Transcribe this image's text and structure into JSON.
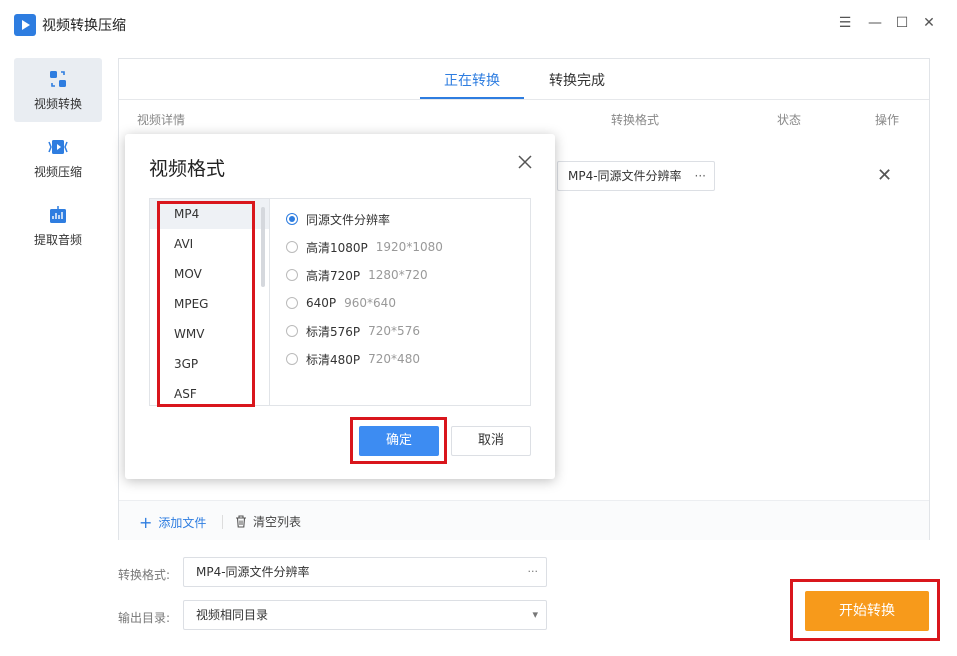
{
  "app": {
    "title": "视频转换压缩"
  },
  "window_controls": {
    "menu": "☰",
    "minimize": "—",
    "maximize": "☐",
    "close": "✕"
  },
  "sidebar": {
    "items": [
      {
        "label": "视频转换",
        "icon": "convert-icon",
        "active": true
      },
      {
        "label": "视频压缩",
        "icon": "compress-icon",
        "active": false
      },
      {
        "label": "提取音频",
        "icon": "audio-icon",
        "active": false
      }
    ]
  },
  "tabs": [
    {
      "label": "正在转换",
      "active": true
    },
    {
      "label": "转换完成",
      "active": false
    }
  ],
  "table": {
    "headers": {
      "details": "视频详情",
      "format": "转换格式",
      "status": "状态",
      "action": "操作"
    },
    "row": {
      "format": "MP4-同源文件分辨率",
      "format_more": "···",
      "delete": "✕"
    }
  },
  "footer": {
    "add_files": "添加文件",
    "clear_list": "清空列表"
  },
  "dialog": {
    "title": "视频格式",
    "formats": [
      "MP4",
      "AVI",
      "MOV",
      "MPEG",
      "WMV",
      "3GP",
      "ASF"
    ],
    "selected_format": "MP4",
    "resolutions": [
      {
        "name": "同源文件分辨率",
        "dim": "",
        "selected": true
      },
      {
        "name": "高清1080P",
        "dim": "1920*1080",
        "selected": false
      },
      {
        "name": "高清720P",
        "dim": "1280*720",
        "selected": false
      },
      {
        "name": "640P",
        "dim": "960*640",
        "selected": false
      },
      {
        "name": "标清576P",
        "dim": "720*576",
        "selected": false
      },
      {
        "name": "标清480P",
        "dim": "720*480",
        "selected": false
      }
    ],
    "ok_label": "确定",
    "cancel_label": "取消"
  },
  "bottom": {
    "format_label": "转换格式:",
    "format_value": "MP4-同源文件分辨率",
    "format_more": "···",
    "output_label": "输出目录:",
    "output_value": "视频相同目录",
    "output_arrow": "▾",
    "start_label": "开始转换"
  },
  "colors": {
    "accent": "#2e7de0",
    "start_button": "#f79a1b",
    "highlight": "#d9161c"
  }
}
